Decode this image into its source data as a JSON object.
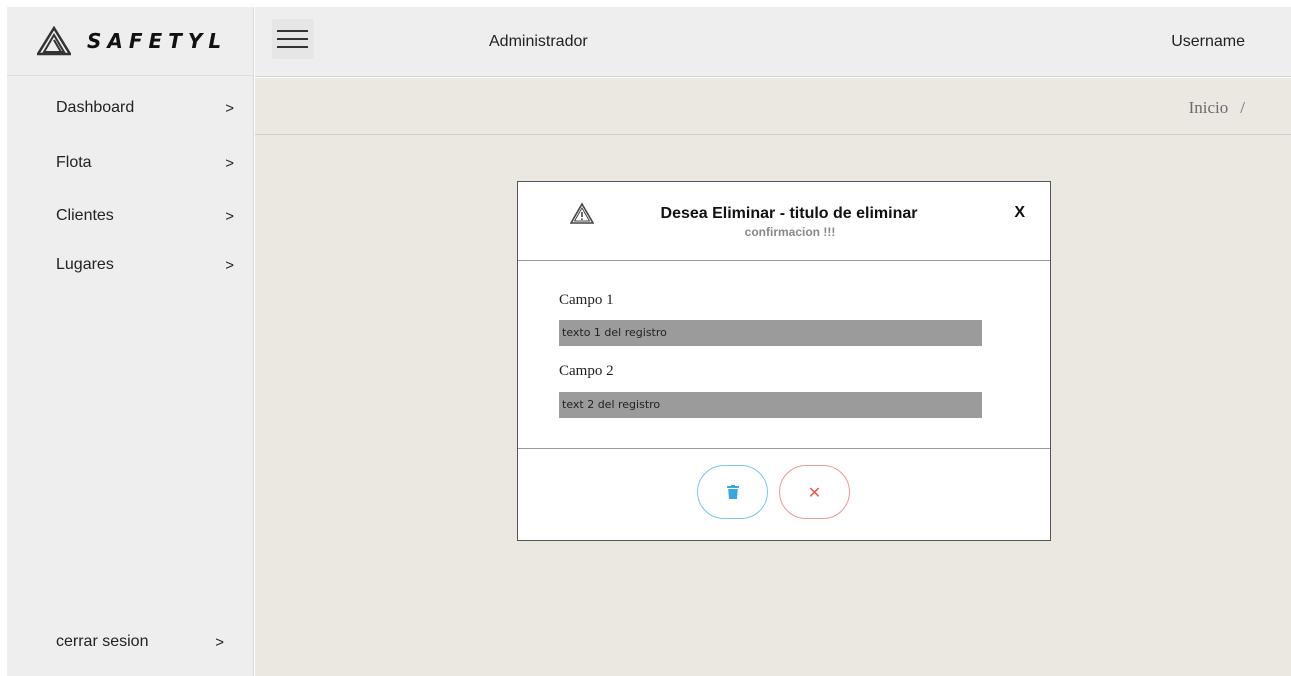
{
  "brand": {
    "name": "SAFETYL",
    "icon": "triangle-logo-icon"
  },
  "sidebar": {
    "items": [
      {
        "label": "Dashboard",
        "chevron": ">"
      },
      {
        "label": "Flota",
        "chevron": ">"
      },
      {
        "label": "Clientes",
        "chevron": ">"
      },
      {
        "label": "Lugares",
        "chevron": ">"
      }
    ],
    "logout": {
      "label": "cerrar sesion",
      "chevron": ">"
    }
  },
  "topbar": {
    "menu_icon": "hamburger-menu-icon",
    "role": "Administrador",
    "username": "Username"
  },
  "breadcrumb": {
    "current": "Inicio",
    "separator": "/"
  },
  "modal": {
    "title": "Desea Eliminar - titulo de eliminar",
    "subtitle": "confirmacion !!!",
    "close_label": "X",
    "fields": [
      {
        "label": "Campo 1",
        "value": "texto 1 del registro"
      },
      {
        "label": "Campo 2",
        "value": "text 2 del registro"
      }
    ],
    "buttons": {
      "delete_icon": "trash-icon",
      "cancel_icon": "close-x-icon",
      "cancel_glyph": "✕"
    }
  },
  "colors": {
    "sidebar_bg": "#eeeeee",
    "content_bg": "#ebe8e2",
    "delete_accent": "#3aa7e0",
    "cancel_accent": "#e15a5a",
    "field_bg": "#9b9b9b"
  }
}
